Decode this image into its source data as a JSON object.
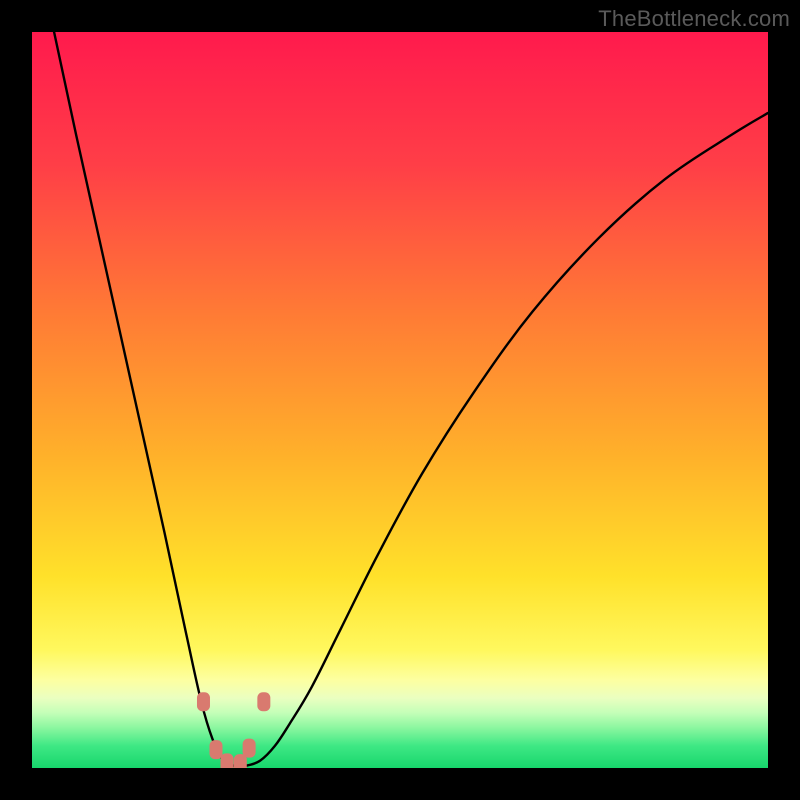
{
  "watermark": "TheBottleneck.com",
  "chart_data": {
    "type": "line",
    "title": "",
    "xlabel": "",
    "ylabel": "",
    "xlim": [
      0,
      100
    ],
    "ylim": [
      0,
      100
    ],
    "note": "Bottleneck V-curve over rainbow gradient. Axes have no visible tick labels; values are implied normalized 0–100. One series only.",
    "series": [
      {
        "name": "bottleneck-curve",
        "x": [
          3,
          6,
          10,
          14,
          18,
          21,
          23,
          24.5,
          26,
          27.5,
          29,
          31,
          33,
          35,
          38,
          42,
          47,
          53,
          60,
          68,
          77,
          86,
          95,
          100
        ],
        "y": [
          100,
          86,
          68,
          50,
          32,
          18,
          9,
          4,
          1,
          0.3,
          0.3,
          1,
          3,
          6,
          11,
          19,
          29,
          40,
          51,
          62,
          72,
          80,
          86,
          89
        ]
      }
    ],
    "markers": [
      {
        "x": 23.3,
        "y": 9.0,
        "shape": "rounded-rect",
        "color": "#d97a6f"
      },
      {
        "x": 31.5,
        "y": 9.0,
        "shape": "rounded-rect",
        "color": "#d97a6f"
      },
      {
        "x": 25.0,
        "y": 2.5,
        "shape": "rounded-rect",
        "color": "#d97a6f"
      },
      {
        "x": 29.5,
        "y": 2.7,
        "shape": "rounded-rect",
        "color": "#d97a6f"
      },
      {
        "x": 26.5,
        "y": 0.7,
        "shape": "rounded-rect",
        "color": "#d97a6f"
      },
      {
        "x": 28.3,
        "y": 0.6,
        "shape": "rounded-rect",
        "color": "#d97a6f"
      }
    ],
    "background_gradient_stops": [
      {
        "pct": 0,
        "color": "#ff1a4d"
      },
      {
        "pct": 18,
        "color": "#ff3e47"
      },
      {
        "pct": 38,
        "color": "#ff7a35"
      },
      {
        "pct": 58,
        "color": "#ffb22a"
      },
      {
        "pct": 74,
        "color": "#ffe12a"
      },
      {
        "pct": 84,
        "color": "#fff85e"
      },
      {
        "pct": 88,
        "color": "#fdffa0"
      },
      {
        "pct": 90.5,
        "color": "#eaffc0"
      },
      {
        "pct": 92.5,
        "color": "#c4ffb8"
      },
      {
        "pct": 94.5,
        "color": "#8cf7a0"
      },
      {
        "pct": 97,
        "color": "#3ee884"
      },
      {
        "pct": 100,
        "color": "#17d66c"
      }
    ]
  }
}
